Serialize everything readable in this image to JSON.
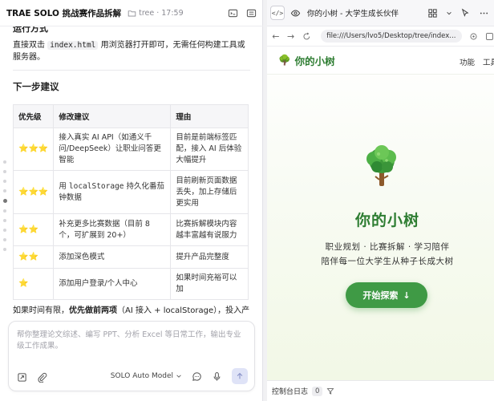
{
  "left": {
    "title": "TRAE SOLO 挑战赛作品拆解",
    "project": "tree",
    "time": "· 17:59",
    "cut_heading": "运行方式",
    "run_text_pre": "直接双击 ",
    "run_code": "index.html",
    "run_text_post": " 用浏览器打开即可，无需任何构建工具或服务器。",
    "next_heading": "下一步建议",
    "table": {
      "headers": [
        "优先级",
        "修改建议",
        "理由"
      ],
      "rows": [
        {
          "stars": "⭐⭐⭐",
          "suggestion": "接入真实 AI API（如通义千问/DeepSeek）让职业问答更智能",
          "reason": "目前是前端标签匹配，接入 AI 后体验大幅提升"
        },
        {
          "stars": "⭐⭐⭐",
          "suggestion_pre": "用 ",
          "suggestion_code": "localStorage",
          "suggestion_post": " 持久化番茄钟数据",
          "reason": "目前刷新页面数据丢失，加上存储后更实用"
        },
        {
          "stars": "⭐⭐",
          "suggestion": "补充更多比赛数据（目前 8 个，可扩展到 20+）",
          "reason": "比赛拆解模块内容越丰富越有说服力"
        },
        {
          "stars": "⭐⭐",
          "suggestion": "添加深色模式",
          "reason": "提升产品完整度"
        },
        {
          "stars": "⭐",
          "suggestion": "添加用户登录/个人中心",
          "reason": "如果时间充裕可以加"
        }
      ]
    },
    "summary_pre": "如果时间有限，",
    "summary_bold": "优先做前两项",
    "summary_post": "（AI 接入 + localStorage），投入产出比最高。",
    "composer": {
      "placeholder": "帮你整理论文综述、编写 PPT、分析 Excel 等日常工作，输出专业级工作成果。",
      "model": "SOLO Auto Model"
    }
  },
  "right": {
    "tab_title": "你的小树 - 大学生成长伙伴",
    "code_toggle": "</>",
    "url": "file:///Users/lvo5/Desktop/tree/index...",
    "site": {
      "logo_emoji": "🌳",
      "logo_text": "你的小树",
      "nav_links": [
        "功能",
        "工具"
      ],
      "hero_title": "你的小树",
      "hero_sub1": "职业规划 · 比赛拆解 · 学习陪伴",
      "hero_sub2": "陪伴每一位大学生从种子长成大树",
      "cta_label": "开始探索",
      "cta_arrow": "↓"
    },
    "console_label": "控制台日志",
    "console_count": "0"
  },
  "colors": {
    "accent_green": "#2e7d32",
    "button_green": "#3f9a45",
    "star": "#f4b400"
  }
}
